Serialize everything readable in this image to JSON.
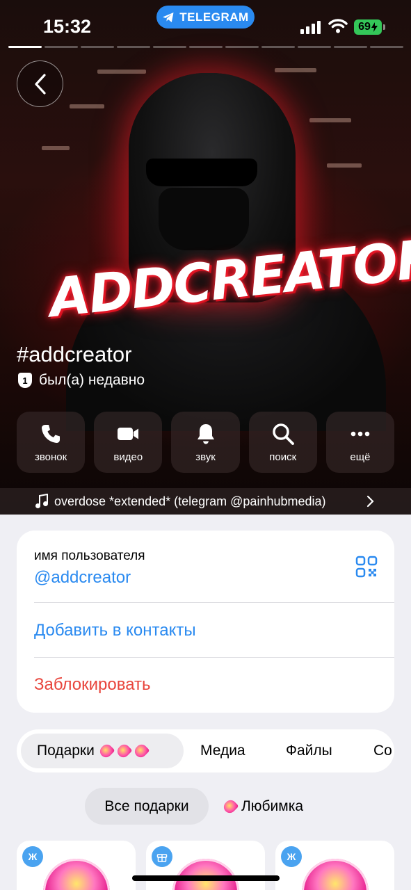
{
  "status_bar": {
    "time": "15:32",
    "pill_label": "TELEGRAM",
    "battery": "69"
  },
  "cover": {
    "logo_text": "ADDCREATOR"
  },
  "profile": {
    "name": "#addcreator",
    "badge_num": "1",
    "last_seen": "был(а) недавно"
  },
  "actions": [
    {
      "label": "звонок",
      "icon": "phone-icon"
    },
    {
      "label": "видео",
      "icon": "video-icon"
    },
    {
      "label": "звук",
      "icon": "bell-icon"
    },
    {
      "label": "поиск",
      "icon": "search-icon"
    },
    {
      "label": "ещё",
      "icon": "more-icon"
    }
  ],
  "music": {
    "track": "overdose *extended* (telegram @painhubmedia)"
  },
  "info_card": {
    "username_label": "имя пользователя",
    "username": "@addcreator",
    "add_contact": "Добавить в контакты",
    "block": "Заблокировать"
  },
  "tabs": [
    {
      "label": "Подарки"
    },
    {
      "label": "Медиа"
    },
    {
      "label": "Файлы"
    },
    {
      "label": "Со"
    }
  ],
  "gift_filters": {
    "all": "Все подарки",
    "favorite": "Любимка"
  },
  "gifts": [
    {
      "tag": "Ж",
      "tag_icon": ""
    },
    {
      "tag": "",
      "tag_icon": "gift-icon"
    },
    {
      "tag": "Ж",
      "tag_icon": ""
    }
  ],
  "colors": {
    "accent": "#2a8af0",
    "danger": "#e8453c",
    "battery": "#34c759"
  }
}
